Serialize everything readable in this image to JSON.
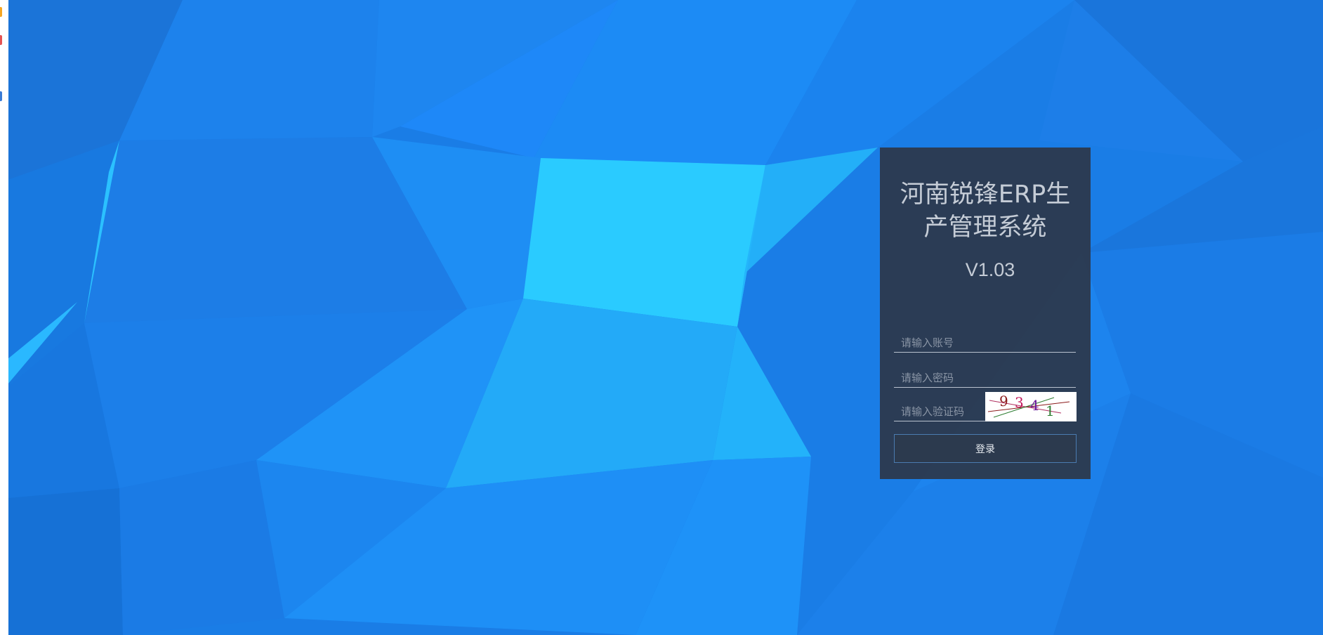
{
  "login": {
    "title": "河南锐锋ERP生产管理系统",
    "version": "V1.03",
    "account_placeholder": "请输入账号",
    "password_placeholder": "请输入密码",
    "captcha_placeholder": "请输入验证码",
    "captcha_text": "9341",
    "login_label": "登录"
  },
  "colors": {
    "background": "#1a7de6",
    "panel": "#2c394d",
    "button_border": "#4a7bb0",
    "left_edge_dots": [
      "#f5a623",
      "#e55353",
      "#3a7bd5"
    ]
  },
  "icons": {
    "background": "low-poly-pattern",
    "captcha": "captcha-image"
  }
}
